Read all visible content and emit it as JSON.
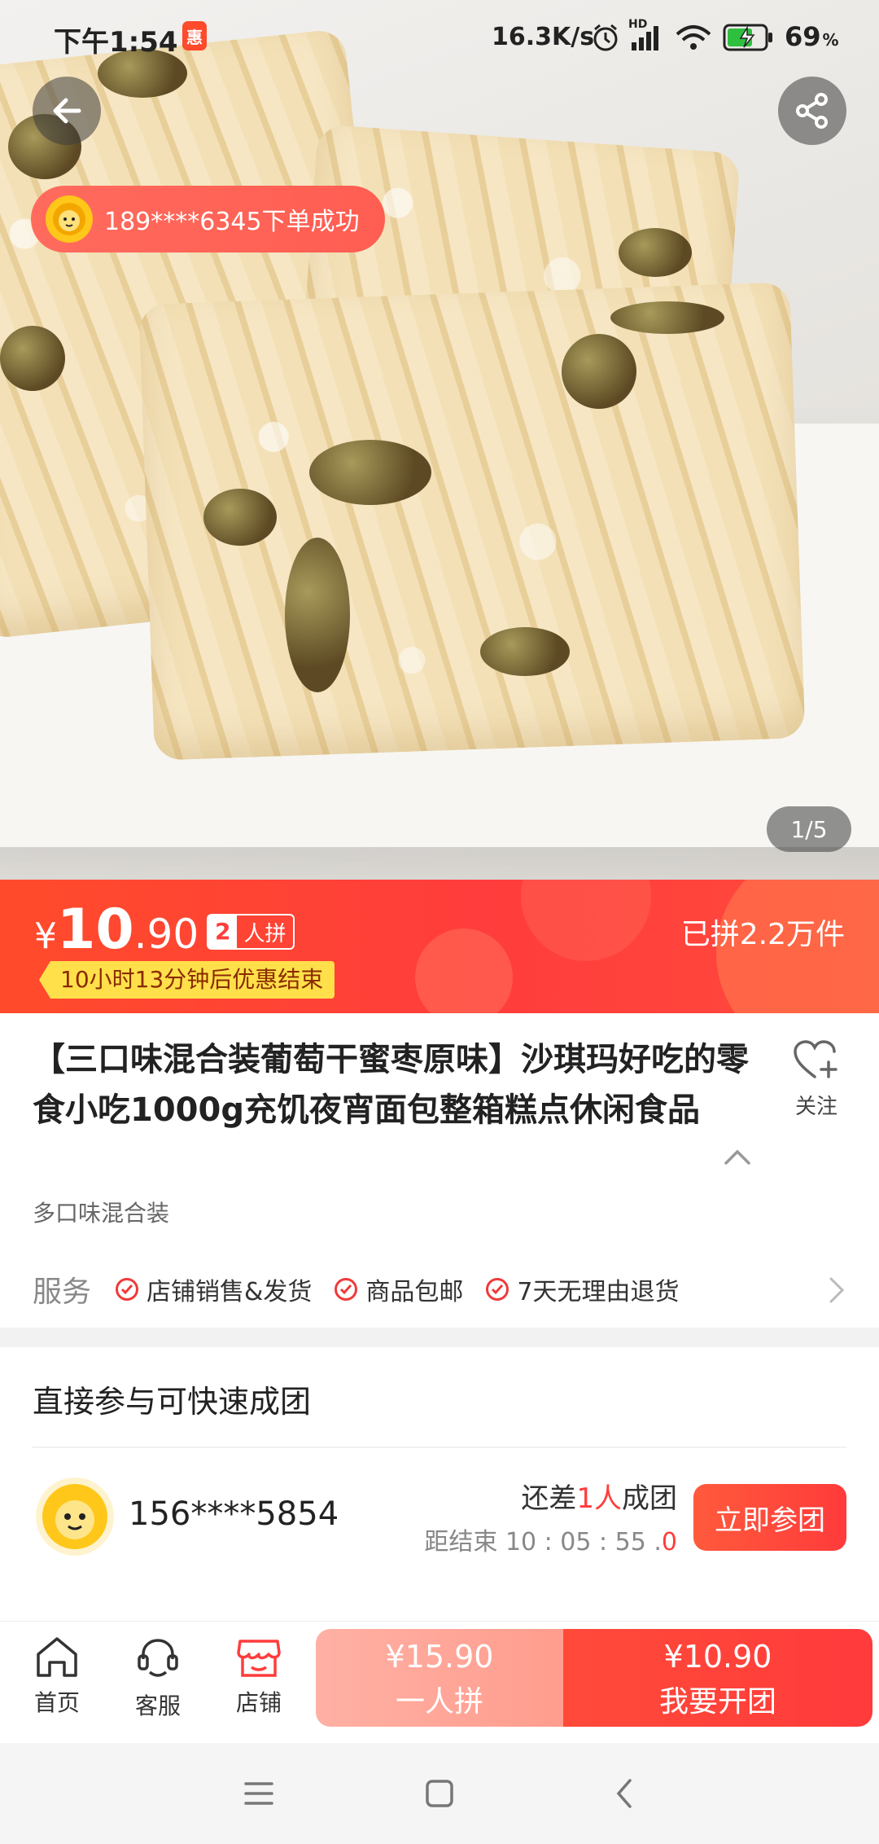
{
  "status_bar": {
    "time": "下午1:54",
    "net_speed": "16.3K/s",
    "hd": "HD",
    "battery": "69",
    "battery_unit": "%"
  },
  "hero": {
    "toast_text": "189****6345下单成功",
    "pager": "1/5"
  },
  "price": {
    "currency": "¥",
    "integer": "10",
    "decimal": ".90",
    "group_count": "2",
    "group_label": "人拼",
    "countdown": "10小时13分钟后优惠结束",
    "sold": "已拼2.2万件"
  },
  "product": {
    "title": "【三口味混合装葡萄干蜜枣原味】沙琪玛好吃的零食小吃1000g充饥夜宵面包整箱糕点休闲食品",
    "spec": "多口味混合装",
    "fav_label": "关注"
  },
  "services": {
    "label": "服务",
    "items": [
      "店铺销售&发货",
      "商品包邮",
      "7天无理由退货"
    ]
  },
  "group": {
    "title": "直接参与可快速成团",
    "user": "156****5854",
    "need_prefix": "还差",
    "need_count": "1人",
    "need_suffix": "成团",
    "end_label": "距结束",
    "end_time": "10 : 05 : 55 .",
    "end_ms": "0",
    "join_label": "立即参团"
  },
  "bottom_bar": {
    "tabs": [
      "首页",
      "客服",
      "店铺"
    ],
    "solo_price": "¥15.90",
    "solo_label": "一人拼",
    "open_price": "¥10.90",
    "open_label": "我要开团"
  },
  "colors": {
    "accent": "#ff3d3c",
    "accent_orange": "#ff4b2b",
    "badge_yellow": "#ffe04a",
    "avatar_yellow": "#ffc71a"
  },
  "icons": [
    "back-arrow-icon",
    "share-icon",
    "heart-plus-icon",
    "check-circle-icon",
    "chevron-right-icon",
    "chevron-up-icon",
    "home-icon",
    "customer-service-icon",
    "store-icon",
    "menu-icon",
    "square-icon",
    "back-chevron-icon"
  ]
}
